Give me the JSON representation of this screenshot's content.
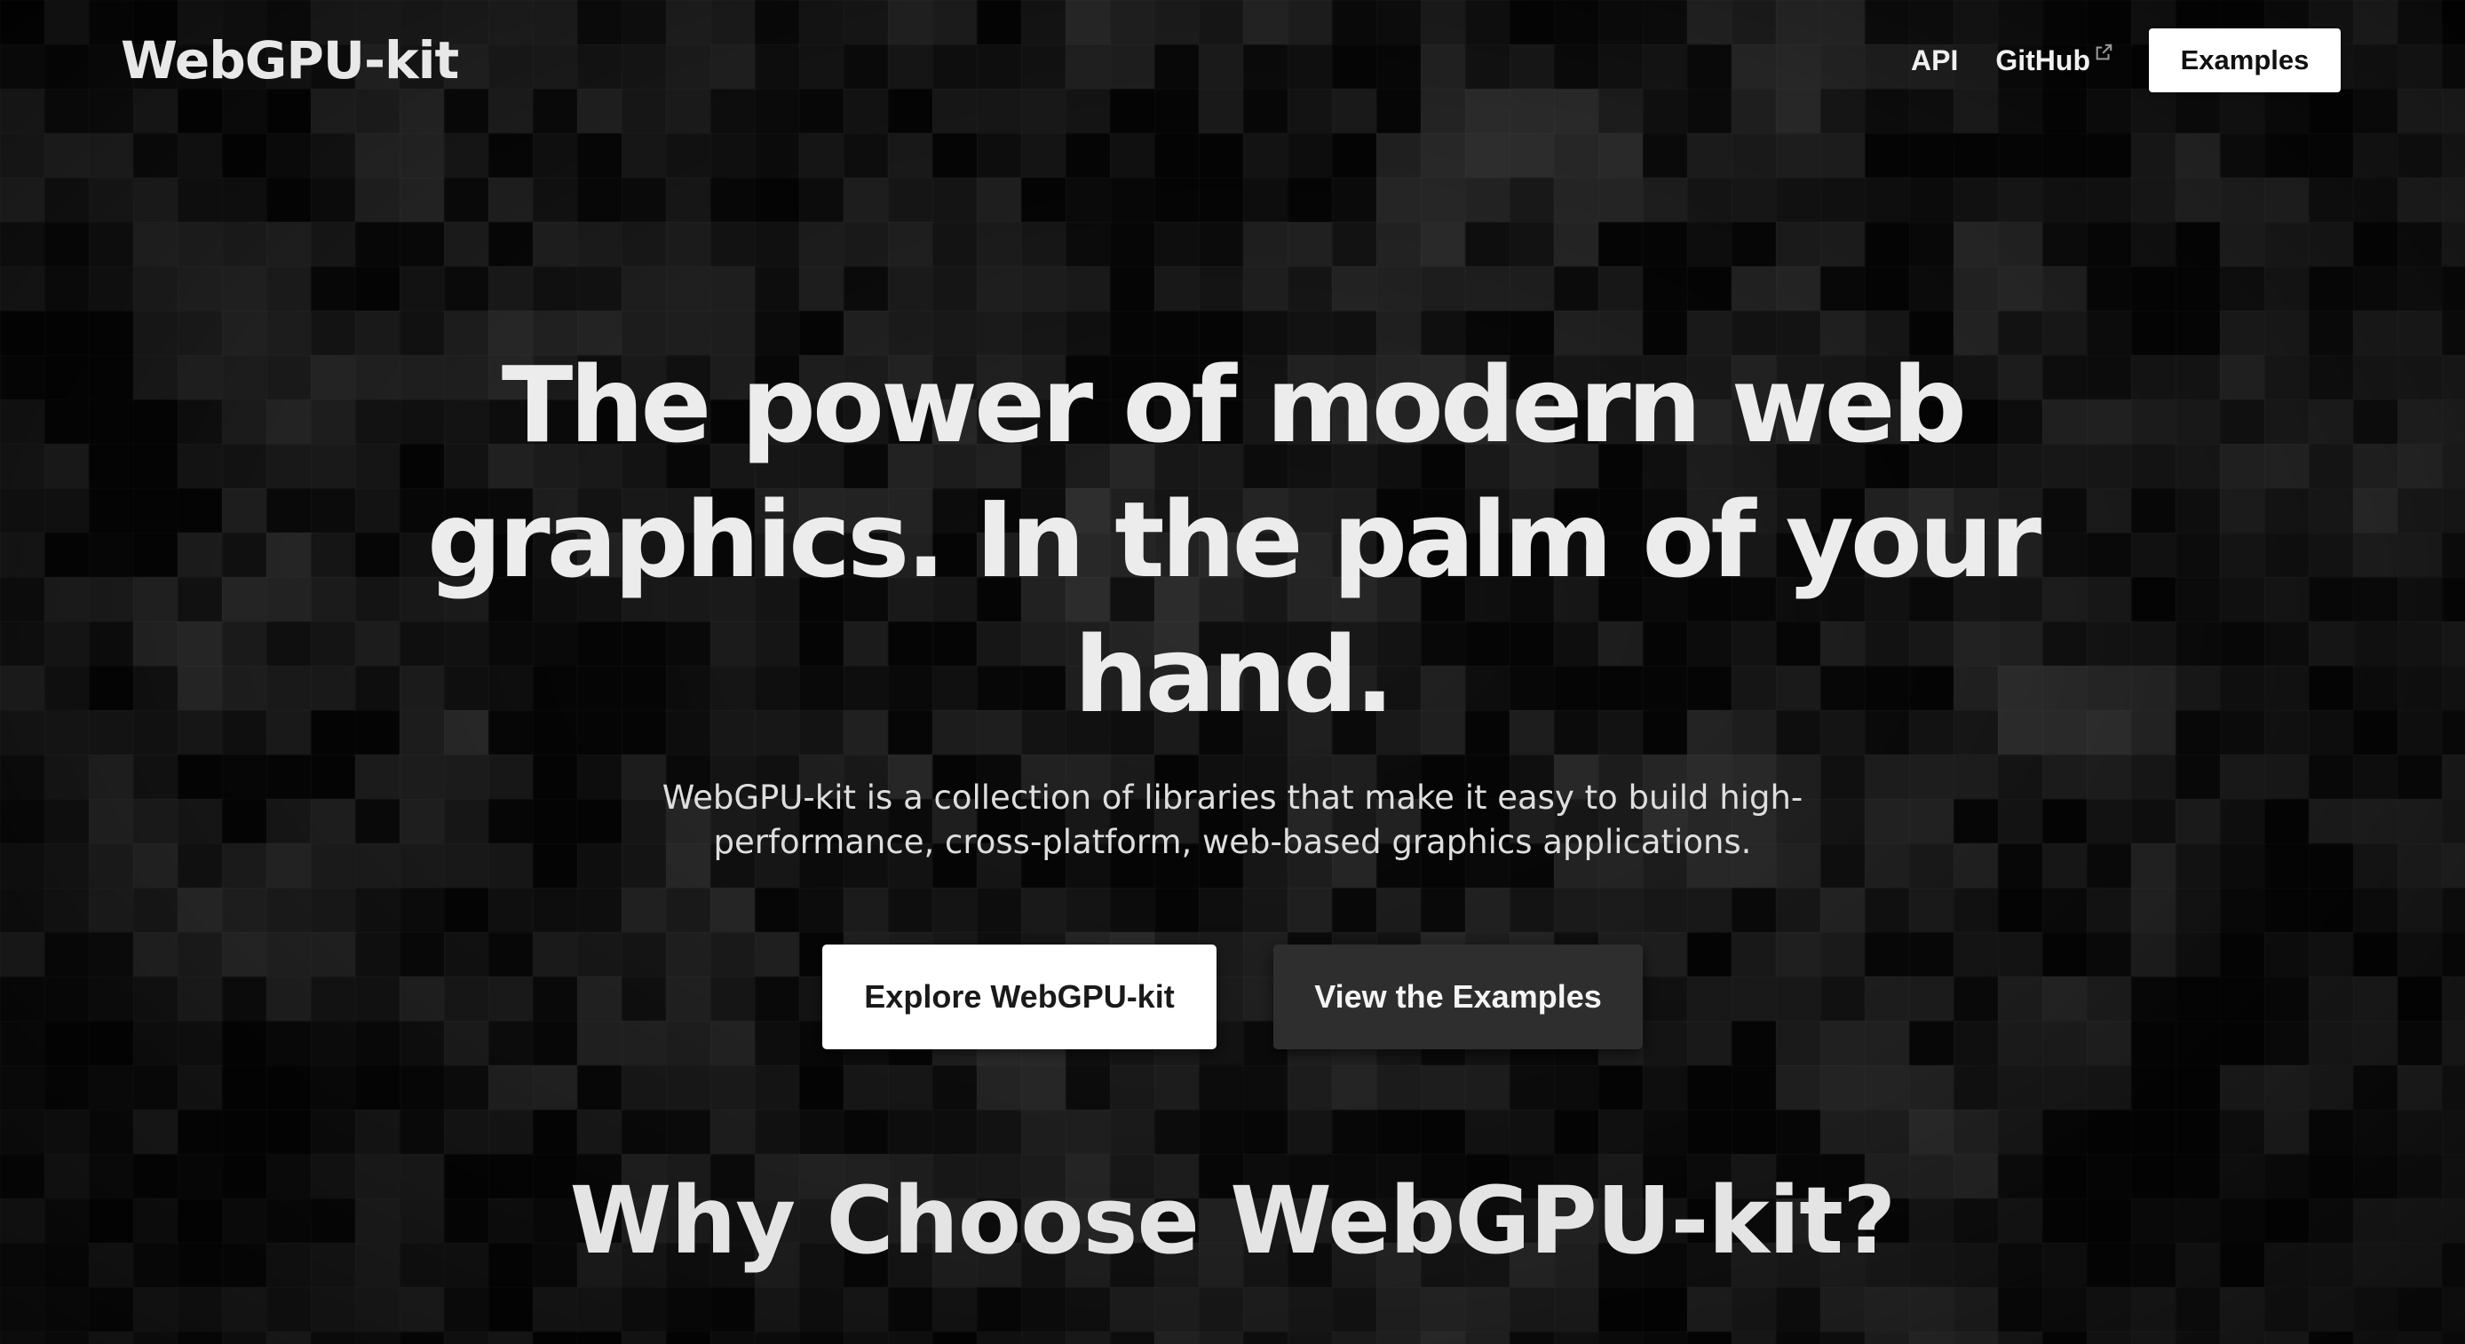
{
  "header": {
    "logo": "WebGPU-kit",
    "nav": {
      "api_label": "API",
      "github_label": "GitHub",
      "examples_label": "Examples"
    }
  },
  "hero": {
    "title_line1": "The power of modern web",
    "title_line2": "graphics. In the palm of your hand.",
    "subtitle_line1": "WebGPU-kit is a collection of libraries that make it easy to build high-",
    "subtitle_line2": "performance, cross-platform, web-based graphics applications.",
    "primary_button": "Explore WebGPU-kit",
    "secondary_button": "View the Examples"
  },
  "section": {
    "title": "Why Choose WebGPU-kit?"
  },
  "icons": {
    "external_link": "external-link-icon"
  },
  "colors": {
    "background": "#050505",
    "text": "#e6e6e6",
    "primary_button_bg": "#ffffff",
    "secondary_button_bg": "#2e2e2e"
  }
}
